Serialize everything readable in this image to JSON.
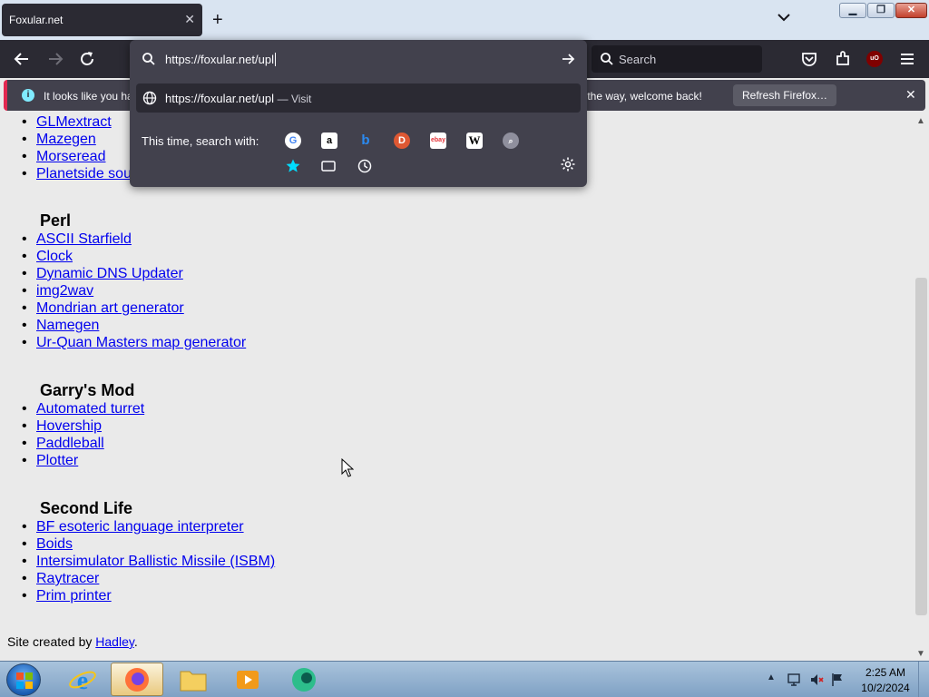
{
  "tab": {
    "title": "Foxular.net",
    "close": "✕"
  },
  "newtab": "+",
  "window_controls": {
    "minimize": "▁",
    "maximize": "❐",
    "close": "✕"
  },
  "toolbar": {
    "search_placeholder": "Search",
    "ublock": "uO"
  },
  "urlbar": {
    "value": "https://foxular.net/upl",
    "suggestion_url": "https://foxular.net/upl",
    "suggestion_action": "Visit",
    "onesearch_label": "This time, search with:",
    "engines": [
      "Google",
      "Amazon",
      "Bing",
      "DuckDuckGo",
      "eBay",
      "Wikipedia",
      "Search"
    ],
    "local_sources": [
      "Bookmarks",
      "Tabs",
      "History"
    ]
  },
  "notification": {
    "text_start": "It looks like you ha",
    "text_end": "y the way, welcome back!",
    "button": "Refresh Firefox…",
    "close": "✕"
  },
  "page": {
    "top_links": [
      "GLMextract",
      "Mazegen",
      "Morseread",
      "Planetside sou"
    ],
    "sections": [
      {
        "title": "Perl",
        "links": [
          "ASCII Starfield",
          "Clock",
          "Dynamic DNS Updater",
          "img2wav",
          "Mondrian art generator",
          "Namegen",
          "Ur-Quan Masters map generator"
        ]
      },
      {
        "title": "Garry's Mod",
        "links": [
          "Automated turret",
          "Hovership",
          "Paddleball",
          "Plotter"
        ]
      },
      {
        "title": "Second Life",
        "links": [
          "BF esoteric language interpreter",
          "Boids",
          "Intersimulator Ballistic Missile (ISBM)",
          "Raytracer",
          "Prim printer"
        ]
      }
    ],
    "footer_prefix": "Site created by ",
    "footer_link": "Hadley",
    "footer_suffix": "."
  },
  "taskbar": {
    "time": "2:25 AM",
    "date": "10/2/2024"
  },
  "colors": {
    "link": "#0000ee",
    "toolbar": "#2b2a33",
    "popup": "#42414d",
    "accent": "#e22850"
  }
}
